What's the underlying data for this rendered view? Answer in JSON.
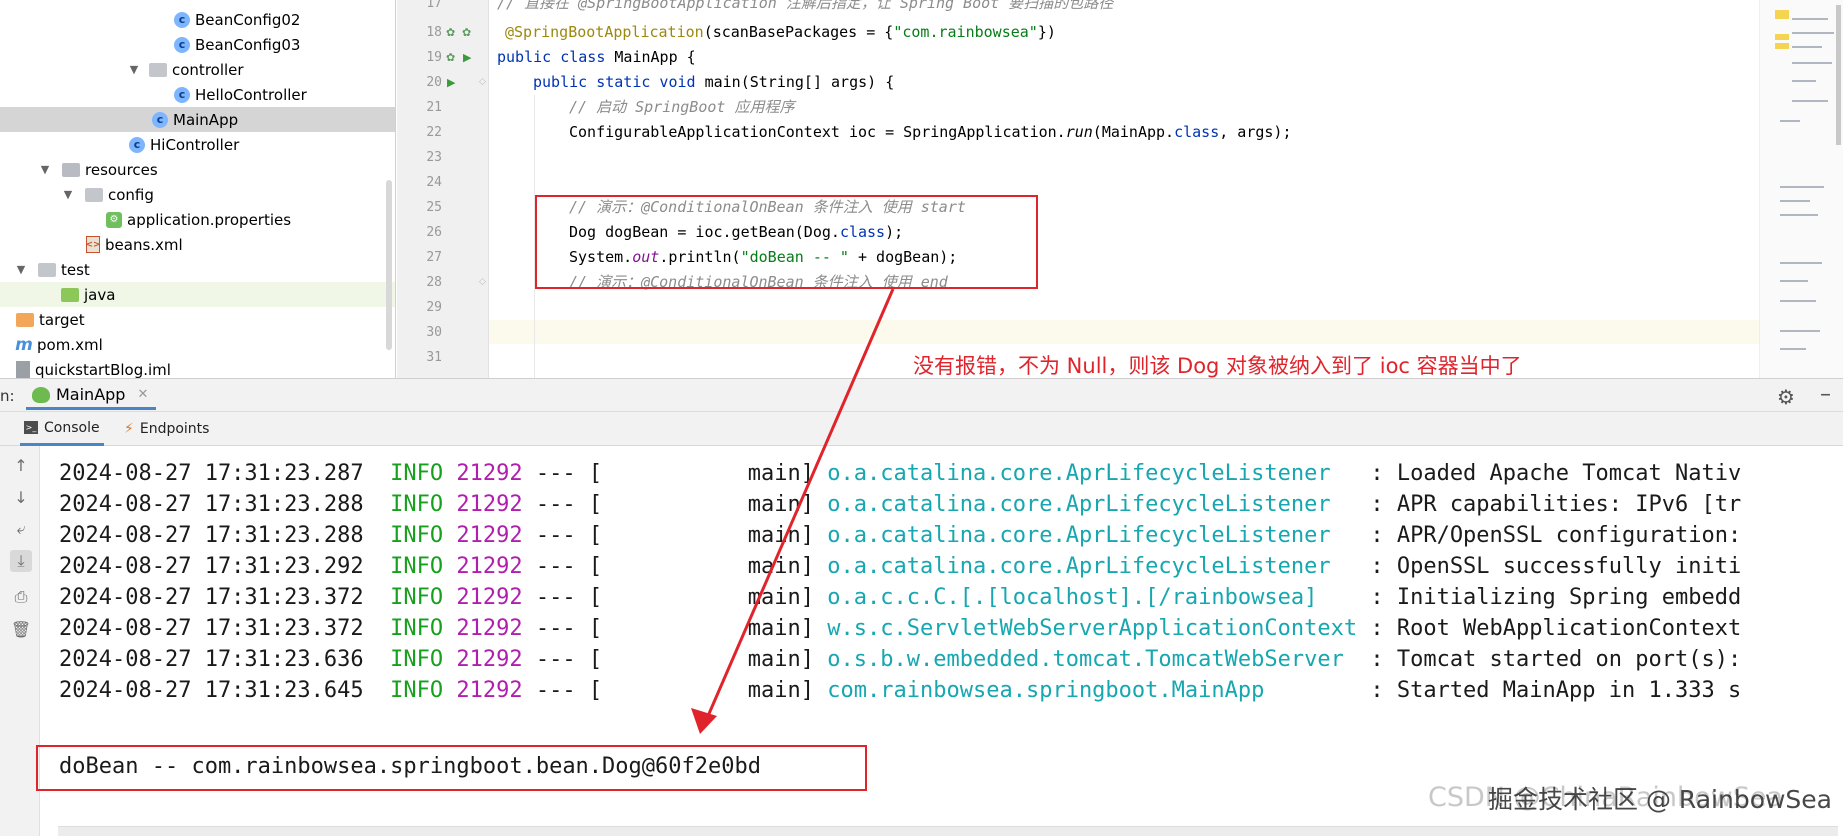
{
  "tree": {
    "items": [
      {
        "label": "BeanConfig02",
        "icon": "class-icon"
      },
      {
        "label": "BeanConfig03",
        "icon": "class-icon"
      },
      {
        "label": "controller",
        "icon": "folder-icon"
      },
      {
        "label": "HelloController",
        "icon": "class-icon"
      },
      {
        "label": "MainApp",
        "icon": "spring-boot-class-icon"
      },
      {
        "label": "HiController",
        "icon": "class-icon"
      },
      {
        "label": "resources",
        "icon": "resources-folder-icon"
      },
      {
        "label": "config",
        "icon": "folder-icon"
      },
      {
        "label": "application.properties",
        "icon": "properties-file-icon"
      },
      {
        "label": "beans.xml",
        "icon": "xml-file-icon"
      },
      {
        "label": "test",
        "icon": "folder-icon"
      },
      {
        "label": "java",
        "icon": "test-source-folder-icon"
      },
      {
        "label": "target",
        "icon": "excluded-folder-icon"
      },
      {
        "label": "pom.xml",
        "icon": "maven-icon"
      },
      {
        "label": "quickstartBlog.iml",
        "icon": "module-file-icon"
      }
    ]
  },
  "editor": {
    "line_numbers": [
      "17",
      "18",
      "19",
      "20",
      "21",
      "22",
      "23",
      "24",
      "25",
      "26",
      "27",
      "28",
      "29",
      "30",
      "31"
    ],
    "lines": {
      "l17_comment": "// 直接在 @SpringBootApplication 注解后指定，让 Spring Boot 要扫描的包路径",
      "l18_annotation": "@SpringBootApplication",
      "l18_rest_a": "(scanBasePackages = {",
      "l18_string": "\"com.rainbowsea\"",
      "l18_rest_b": "})",
      "l19_kw": "public class",
      "l19_rest": " MainApp {",
      "l20_kw": "public static void",
      "l20_rest": " main(String[] args) {",
      "l21_comment": "// 启动 SpringBoot 应用程序",
      "l22_a": "ConfigurableApplicationContext ioc = SpringApplication.",
      "l22_method": "run",
      "l22_b": "(MainApp.",
      "l22_kw": "class",
      "l22_c": ", args);",
      "l25_comment": "// 演示：@ConditionalOnBean 条件注入 使用 start",
      "l26_a": "Dog dogBean = ioc.getBean(Dog.",
      "l26_kw": "class",
      "l26_b": ");",
      "l27_a": "System.",
      "l27_field": "out",
      "l27_b": ".println(",
      "l27_string": "\"doBean -- \"",
      "l27_c": " + dogBean);",
      "l28_comment": "// 演示：@ConditionalOnBean 条件注入 使用 end"
    },
    "annotation_note": "没有报错，不为 Null，则该 Dog 对象被纳入到了 ioc 容器当中了"
  },
  "run_panel": {
    "prefix": "n:",
    "tab_label": "MainApp",
    "console_tab": "Console",
    "endpoints_tab": "Endpoints"
  },
  "console": {
    "log_lines": [
      {
        "ts": "2024-08-27 17:31:23.287",
        "level": "INFO",
        "pid": "21292",
        "sep": "---",
        "thread": "[           main]",
        "logger": "o.a.catalina.core.AprLifecycleListener  ",
        "msg": ": Loaded Apache Tomcat Nativ"
      },
      {
        "ts": "2024-08-27 17:31:23.288",
        "level": "INFO",
        "pid": "21292",
        "sep": "---",
        "thread": "[           main]",
        "logger": "o.a.catalina.core.AprLifecycleListener  ",
        "msg": ": APR capabilities: IPv6 [tr"
      },
      {
        "ts": "2024-08-27 17:31:23.288",
        "level": "INFO",
        "pid": "21292",
        "sep": "---",
        "thread": "[           main]",
        "logger": "o.a.catalina.core.AprLifecycleListener  ",
        "msg": ": APR/OpenSSL configuration:"
      },
      {
        "ts": "2024-08-27 17:31:23.292",
        "level": "INFO",
        "pid": "21292",
        "sep": "---",
        "thread": "[           main]",
        "logger": "o.a.catalina.core.AprLifecycleListener  ",
        "msg": ": OpenSSL successfully initi"
      },
      {
        "ts": "2024-08-27 17:31:23.372",
        "level": "INFO",
        "pid": "21292",
        "sep": "---",
        "thread": "[           main]",
        "logger": "o.a.c.c.C.[.[localhost].[/rainbowsea]   ",
        "msg": ": Initializing Spring embedd"
      },
      {
        "ts": "2024-08-27 17:31:23.372",
        "level": "INFO",
        "pid": "21292",
        "sep": "---",
        "thread": "[           main]",
        "logger": "w.s.c.ServletWebServerApplicationContext",
        "msg": ": Root WebApplicationContext"
      },
      {
        "ts": "2024-08-27 17:31:23.636",
        "level": "INFO",
        "pid": "21292",
        "sep": "---",
        "thread": "[           main]",
        "logger": "o.s.b.w.embedded.tomcat.TomcatWebServer ",
        "msg": ": Tomcat started on port(s):"
      },
      {
        "ts": "2024-08-27 17:31:23.645",
        "level": "INFO",
        "pid": "21292",
        "sep": "---",
        "thread": "[           main]",
        "logger": "com.rainbowsea.springboot.MainApp       ",
        "msg": ": Started MainApp in 1.333 s"
      }
    ],
    "output_line": "doBean -- com.rainbowsea.springboot.bean.Dog@60f2e0bd"
  },
  "watermark": {
    "back": "CSDN @ChinaRainbowSea",
    "front": "掘金技术社区 @ RainbowSea"
  },
  "colors": {
    "highlight_red": "#e0242c",
    "log_level_green": "#17a01d",
    "pid_magenta": "#b01eae",
    "logger_teal": "#16a7b0",
    "keyword_blue": "#0033b3"
  }
}
